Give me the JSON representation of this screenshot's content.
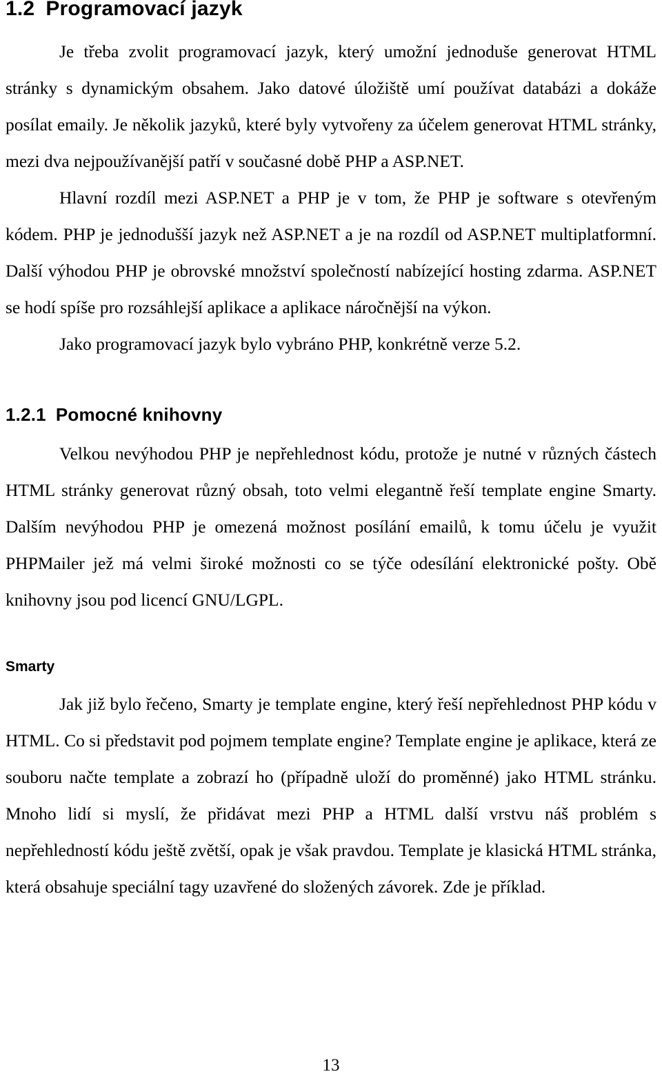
{
  "document": {
    "language": "cs",
    "page_number": "13"
  },
  "section_heading": {
    "number": "1.2",
    "title": "Programovací jazyk"
  },
  "paragraphs": {
    "intro": "Je třeba zvolit programovací jazyk, který umožní jednoduše generovat HTML stránky s dynamickým obsahem. Jako datové úložiště umí používat databázi a dokáže posílat emaily. Je několik jazyků, které byly vytvořeny za účelem generovat HTML stránky, mezi dva nejpoužívanější patří v současné době PHP a ASP.NET.",
    "comparison": "Hlavní rozdíl mezi ASP.NET a PHP je v tom, že PHP je software s otevřeným kódem. PHP je jednodušší jazyk než ASP.NET a je na rozdíl od ASP.NET multiplatformní. Další výhodou PHP je obrovské množství společností nabízející hosting zdarma. ASP.NET se hodí spíše pro rozsáhlejší aplikace a aplikace náročnější na výkon.",
    "choice": "Jako programovací jazyk bylo vybráno PHP, konkrétně verze 5.2."
  },
  "subsection_heading": {
    "number": "1.2.1",
    "title": "Pomocné knihovny"
  },
  "subsection_paragraphs": {
    "libraries": "Velkou nevýhodou PHP je nepřehlednost kódu, protože je nutné v různých částech HTML stránky generovat různý obsah, toto velmi elegantně řeší template engine Smarty. Dalším nevýhodou PHP je omezená možnost posílání emailů, k tomu účelu je využit PHPMailer jež má velmi široké možnosti co se týče odesílání elektronické pošty. Obě knihovny jsou pod licencí GNU/LGPL."
  },
  "minor_heading": {
    "title": "Smarty"
  },
  "minor_paragraphs": {
    "smarty": "Jak již bylo řečeno, Smarty je template engine, který řeší nepřehlednost PHP kódu v HTML. Co si představit pod pojmem template engine? Template engine je aplikace, která ze souboru načte template a zobrazí ho (případně uloží do proměnné) jako HTML stránku. Mnoho lidí si myslí, že přidávat mezi PHP a HTML další vrstvu náš problém s nepřehledností kódu ještě zvětší, opak je však pravdou. Template je klasická HTML stránka, která obsahuje speciální tagy uzavřené do složených závorek. Zde je příklad."
  },
  "footer": {
    "page_label": "13"
  }
}
